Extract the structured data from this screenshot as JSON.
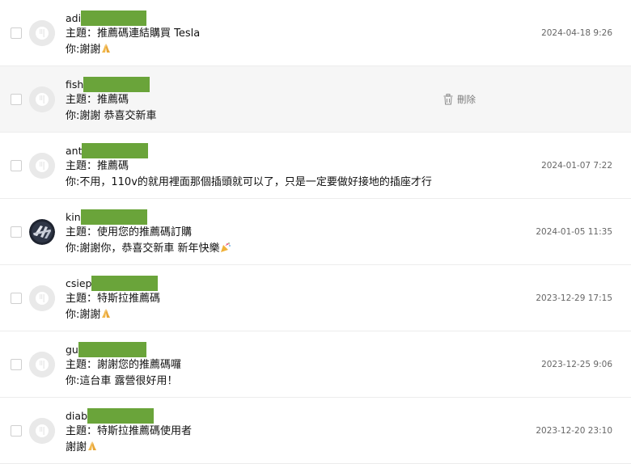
{
  "messages": [
    {
      "sender": "adi",
      "subject": "主題：推薦碼連結購買 Tesla",
      "preview": "你:謝謝",
      "preview_emoji": "folded-hands",
      "date": "2024-04-18 9:26"
    },
    {
      "sender": "fish",
      "subject": "主題：推薦碼",
      "preview": "你:謝謝 恭喜交新車",
      "delete_label": "刪除"
    },
    {
      "sender": "ant",
      "subject": "主題：推薦碼",
      "preview": "你:不用，110v的就用裡面那個插頭就可以了，只是一定要做好接地的插座才行",
      "date": "2024-01-07 7:22"
    },
    {
      "sender": "kin",
      "subject": "主題：使用您的推薦碼訂購",
      "preview": "你:謝謝你，恭喜交新車 新年快樂",
      "preview_emoji": "party-popper",
      "date": "2024-01-05 11:35"
    },
    {
      "sender": "csiep",
      "subject": "主題：特斯拉推薦碼",
      "preview": "你:謝謝",
      "preview_emoji": "folded-hands",
      "date": "2023-12-29 17:15"
    },
    {
      "sender": "gu",
      "subject": "主題：謝謝您的推薦碼囉",
      "preview": "你:這台車 露營很好用！",
      "date": "2023-12-25 9:06"
    },
    {
      "sender": "diab",
      "subject": "主題：特斯拉推薦碼使用者",
      "preview": "謝謝",
      "preview_emoji": "folded-hands",
      "date": "2023-12-20 23:10"
    }
  ],
  "colors": {
    "redaction": "#6aa43a",
    "hover_row": "#f6f6f6",
    "date_text": "#666666"
  }
}
